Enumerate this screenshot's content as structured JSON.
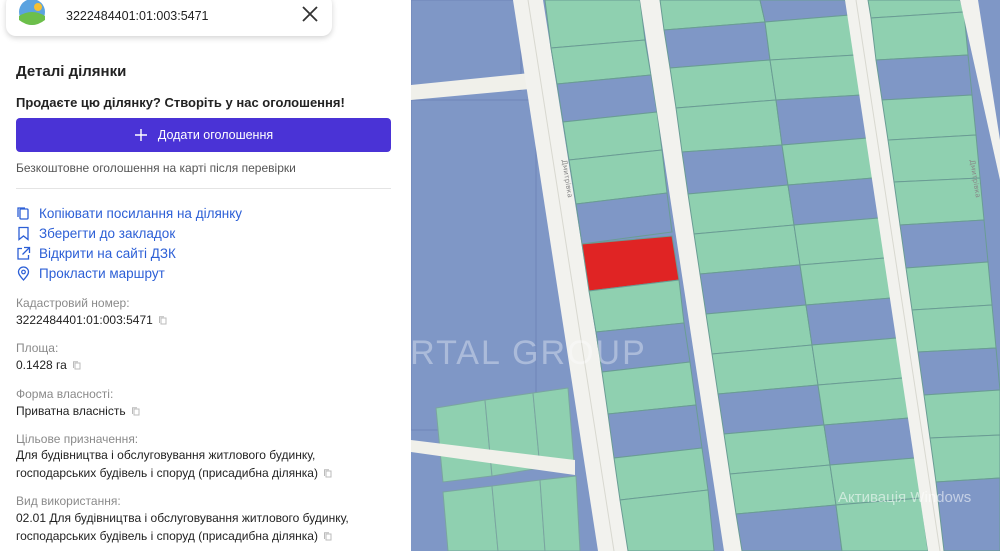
{
  "search": {
    "value": "3222484401:01:003:5471"
  },
  "details": {
    "title": "Деталі ділянки",
    "sell_prompt": "Продаєте цю ділянку? Створіть у нас оголошення!",
    "add_button_label": "Додати оголошення",
    "free_note": "Безкоштовне оголошення на карті після перевірки"
  },
  "links": {
    "copy": "Копіювати посилання на ділянку",
    "bookmark": "Зберегти до закладок",
    "dzk": "Відкрити на сайті ДЗК",
    "route": "Прокласти маршрут"
  },
  "fields": {
    "cadastral_label": "Кадастровий номер:",
    "cadastral_value": "3222484401:01:003:5471",
    "area_label": "Площа:",
    "area_value": "0.1428 га",
    "ownership_label": "Форма власності:",
    "ownership_value": "Приватна власність",
    "purpose_label": "Цільове призначення:",
    "purpose_line1": "Для будівництва і обслуговування житлового будинку,",
    "purpose_line2": "господарських будівель і споруд (присадибна ділянка)",
    "usage_label": "Вид використання:",
    "usage_line1": "02.01 Для будівництва і обслуговування житлового будинку,",
    "usage_line2": "господарських будівель і споруд (присадибна ділянка)"
  },
  "map": {
    "street_left": "Дмитрівка",
    "street_right": "Дмитрівка",
    "watermark": "PORTAL GROUP",
    "windows_activation": "Активація Windows",
    "colors": {
      "parcel_blue": "#7f97c6",
      "parcel_green": "#8fd0b0",
      "road": "#f2f2ee",
      "selected": "#e02424"
    }
  },
  "colors": {
    "accent": "#4a33d6",
    "link": "#2c5fd6"
  }
}
